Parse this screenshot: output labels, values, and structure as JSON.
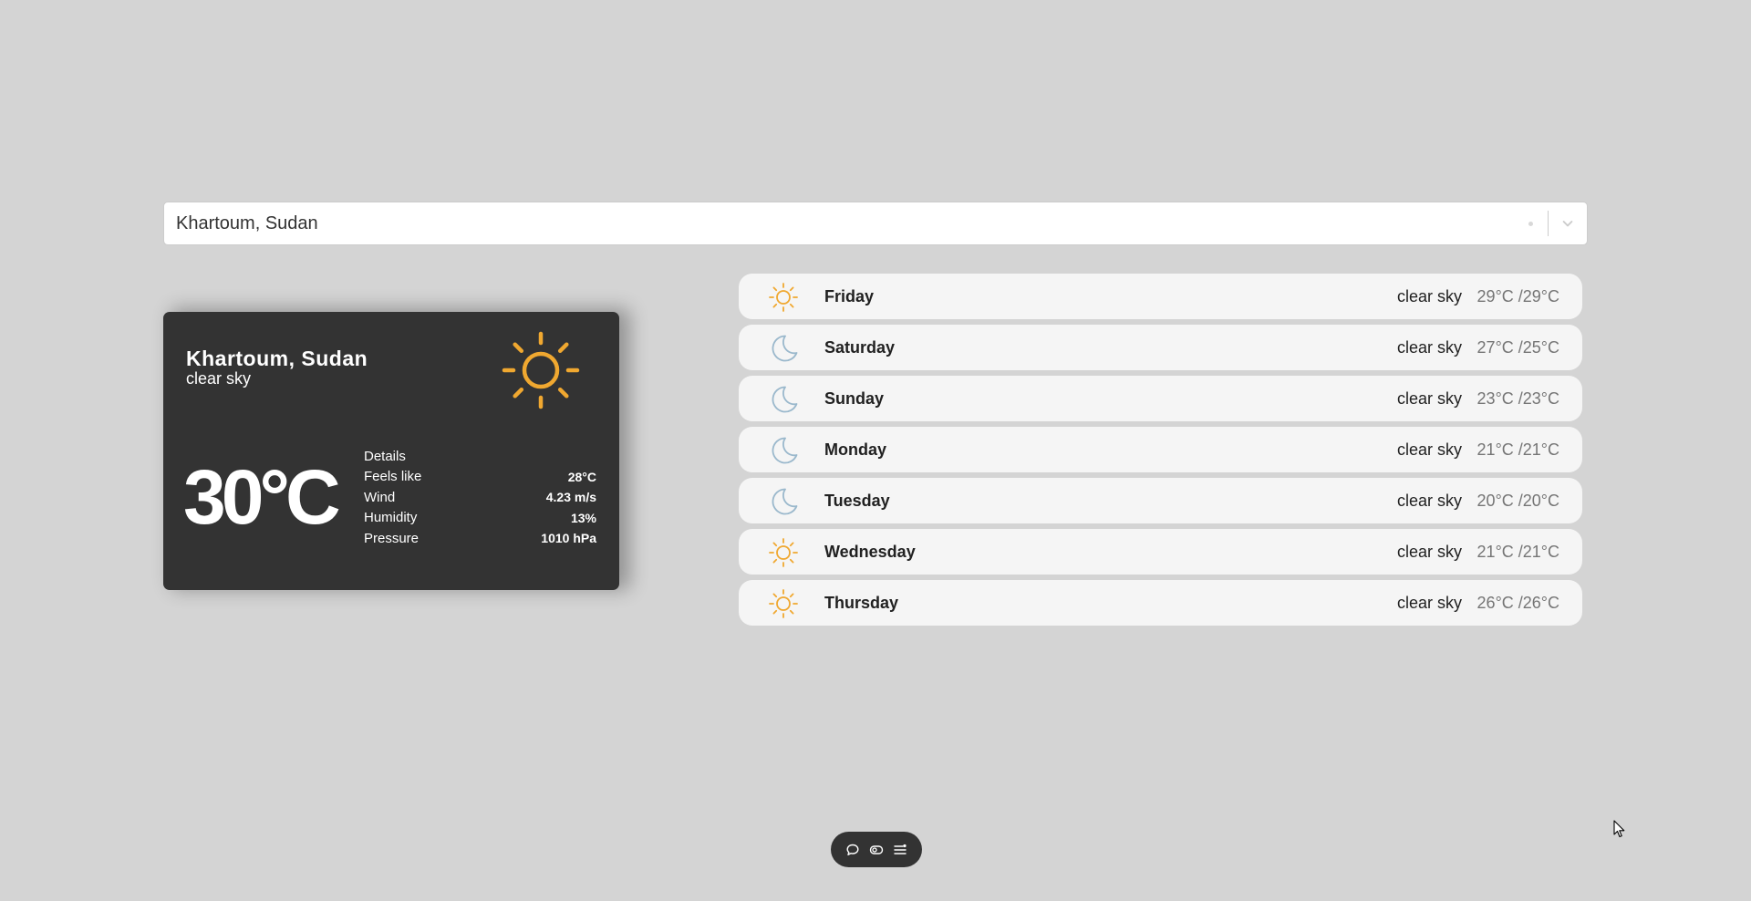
{
  "search": {
    "value": "Khartoum, Sudan"
  },
  "current": {
    "city": "Khartoum, Sudan",
    "description": "clear sky",
    "icon": "sun-icon",
    "temperature": "30°C",
    "details_label": "Details",
    "details": [
      {
        "label": "Feels like",
        "value": "28°C"
      },
      {
        "label": "Wind",
        "value": "4.23 m/s"
      },
      {
        "label": "Humidity",
        "value": "13%"
      },
      {
        "label": "Pressure",
        "value": "1010 hPa"
      }
    ]
  },
  "forecast": [
    {
      "day": "Friday",
      "description": "clear sky",
      "temps": "29°C /29°C",
      "icon": "sun-icon"
    },
    {
      "day": "Saturday",
      "description": "clear sky",
      "temps": "27°C /25°C",
      "icon": "moon-icon"
    },
    {
      "day": "Sunday",
      "description": "clear sky",
      "temps": "23°C /23°C",
      "icon": "moon-icon"
    },
    {
      "day": "Monday",
      "description": "clear sky",
      "temps": "21°C /21°C",
      "icon": "moon-icon"
    },
    {
      "day": "Tuesday",
      "description": "clear sky",
      "temps": "20°C /20°C",
      "icon": "moon-icon"
    },
    {
      "day": "Wednesday",
      "description": "clear sky",
      "temps": "21°C /21°C",
      "icon": "sun-icon"
    },
    {
      "day": "Thursday",
      "description": "clear sky",
      "temps": "26°C /26°C",
      "icon": "sun-icon"
    }
  ],
  "toolbar": {
    "items": [
      "chat-icon",
      "toggle-icon",
      "menu-icon"
    ]
  },
  "colors": {
    "background": "#d4d4d4",
    "card": "#333333",
    "sun": "#f0a830",
    "moon": "#9ab8cc",
    "forecast_item": "#f5f5f5"
  }
}
